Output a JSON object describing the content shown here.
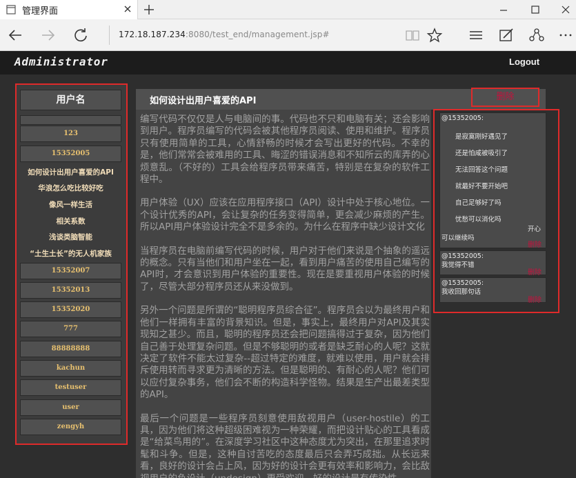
{
  "browser": {
    "tab_title": "管理界面",
    "url_main": "172.18.187.234",
    "url_rest": ":8080/test_end/management.jsp#"
  },
  "header": {
    "brand": "Administrator",
    "logout_label": "Logout"
  },
  "sidebar": {
    "title": "用户名",
    "users_top": [
      "123",
      "15352005"
    ],
    "articles": [
      "如何设计出用户喜爱的API",
      "华浪怎么吃比较好吃",
      "像风一样生活",
      "相关系数",
      "浅谈类脑智能",
      "“土生土长”的无人机家族"
    ],
    "users_bottom": [
      "15352007",
      "15352013",
      "15352020",
      "777",
      "88888888",
      "kachun",
      "testuser",
      "user",
      "zengyh"
    ]
  },
  "article": {
    "title": "如何设计出用户喜爱的API",
    "delete_label": "删除",
    "paragraphs": [
      "编写代码不仅仅是人与电脑间的事。代码也不只和电脑有关；还会影响到用户。程序员编写的代码会被其他程序员阅读、使用和维护。程序员只有使用简单的工具，心情舒畅的时候才会写出更好的代码。不幸的是，他们常常会被难用的工具、晦涩的错误消息和不知所云的库弄的心烦意乱。（不好的）工具会给程序员带来痛苦，特别是在复杂的软件工程中。",
      "用户体验（UX）应该在应用程序接口（API）设计中处于核心地位。一个设计优秀的API，会让复杂的任务变得简单，更会减少麻烦的产生。所以API用户体验设计完全不是多余的。为什么在程序中缺少设计文化",
      "当程序员在电脑前编写代码的时候，用户对于他们来说是个抽象的遥远的概念。只有当他们和用户坐在一起，看到用户痛苦的使用自己编写的API时，才会意识到用户体验的重要性。现在是要重视用户体验的时候了，尽管大部分程序员还从来没做到。",
      "另外一个问题是所谓的“聪明程序员综合征”。程序员会以为最终用户和他们一样拥有丰富的背景知识。但是，事实上，最终用户对API及其实现知之甚少。而且，聪明的程序员还会把问题搞得过于复杂，因为他们自己善于处理复杂问题。但是不够聪明的或者是缺乏耐心的人呢？这就决定了软件不能太过复杂--超过特定的难度，就难以使用，用户就会排斥使用转而寻求更为清晰的方法。但是聪明的、有耐心的人呢？他们可以应付复杂事务，他们会不断的构造科学怪物。结果是生产出最差类型的API。",
      "最后一个问题是一些程序员刻意使用敌视用户（user-hostile）的工具，因为他们将这种超级困难视为一种荣耀，而把设计贴心的工具看成是“给菜鸟用的”。在深度学习社区中这种态度尤为突出，在那里追求时髦和斗争。但是，这种自讨苦吃的态度最后只会弄巧成拙。从长远来看，良好的设计会占上风，因为好的设计会更有效率和影响力，会比敌视用户的负设计（undesign）更受欢迎。好的设计是有传染性"
    ]
  },
  "comments": {
    "delete_label": "删除",
    "items": [
      {
        "user": "@15352005:",
        "lines": [
          "是寂寞刚好遇见了",
          "还是怕咸被吸引了",
          "无法回答这个问题",
          "就最好不要开始吧",
          "自己足够好了吗",
          "忧愁可以消化吗",
          "开心",
          "可以继续吗"
        ]
      },
      {
        "user": "@15352005:",
        "lines": [
          "我觉得不错"
        ]
      },
      {
        "user": "@15352005:",
        "lines": [
          "我收回那句话"
        ]
      }
    ]
  },
  "colors": {
    "highlight_border": "#e02a2a",
    "delete_text": "#c4123d",
    "user_button_text": "#e7c06f"
  }
}
